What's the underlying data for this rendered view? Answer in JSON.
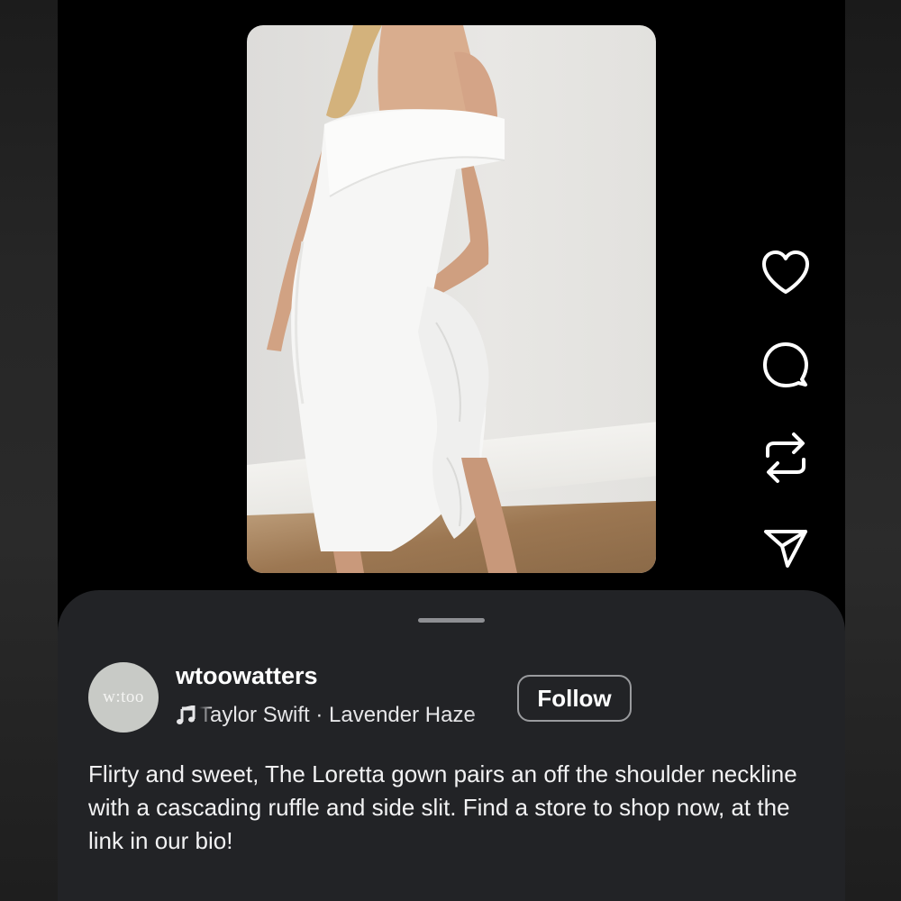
{
  "post": {
    "username": "wtoowatters",
    "avatar_text": "w:too",
    "music": "Taylor Swift · Lavender Haze",
    "follow_label": "Follow",
    "caption": "Flirty and sweet, The Loretta gown pairs an off the shoulder neckline with a cascading ruffle and side slit. Find a store to shop now, at the link in our bio!"
  },
  "actions": [
    {
      "icon": "heart-icon",
      "label": "like"
    },
    {
      "icon": "comment-icon",
      "label": "comment"
    },
    {
      "icon": "repost-icon",
      "label": "repost"
    },
    {
      "icon": "share-icon",
      "label": "share"
    }
  ],
  "colors": {
    "background": "#000000",
    "sheet": "#222326",
    "text": "#ffffff",
    "button_border": "#9a9b9e"
  }
}
